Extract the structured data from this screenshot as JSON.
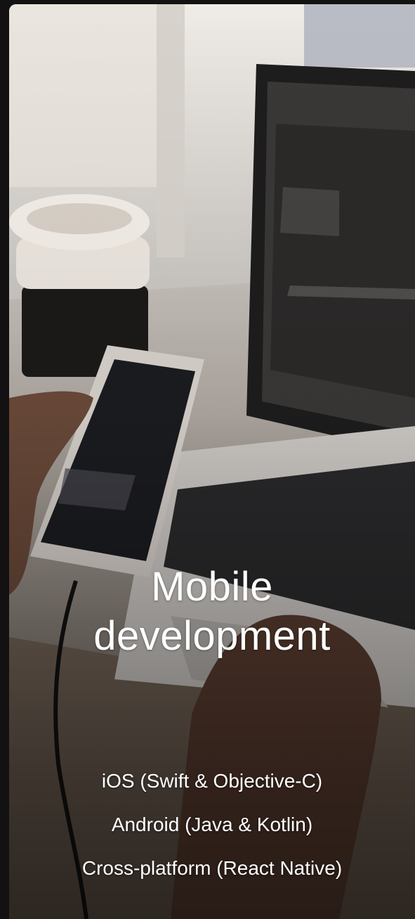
{
  "hero": {
    "image": "laptop-phone-coffee-photo",
    "title_line1": "Mobile",
    "title_line2": "development"
  },
  "platforms": [
    "iOS (Swift & Objective-C)",
    "Android (Java & Kotlin)",
    "Cross-platform (React Native)"
  ]
}
